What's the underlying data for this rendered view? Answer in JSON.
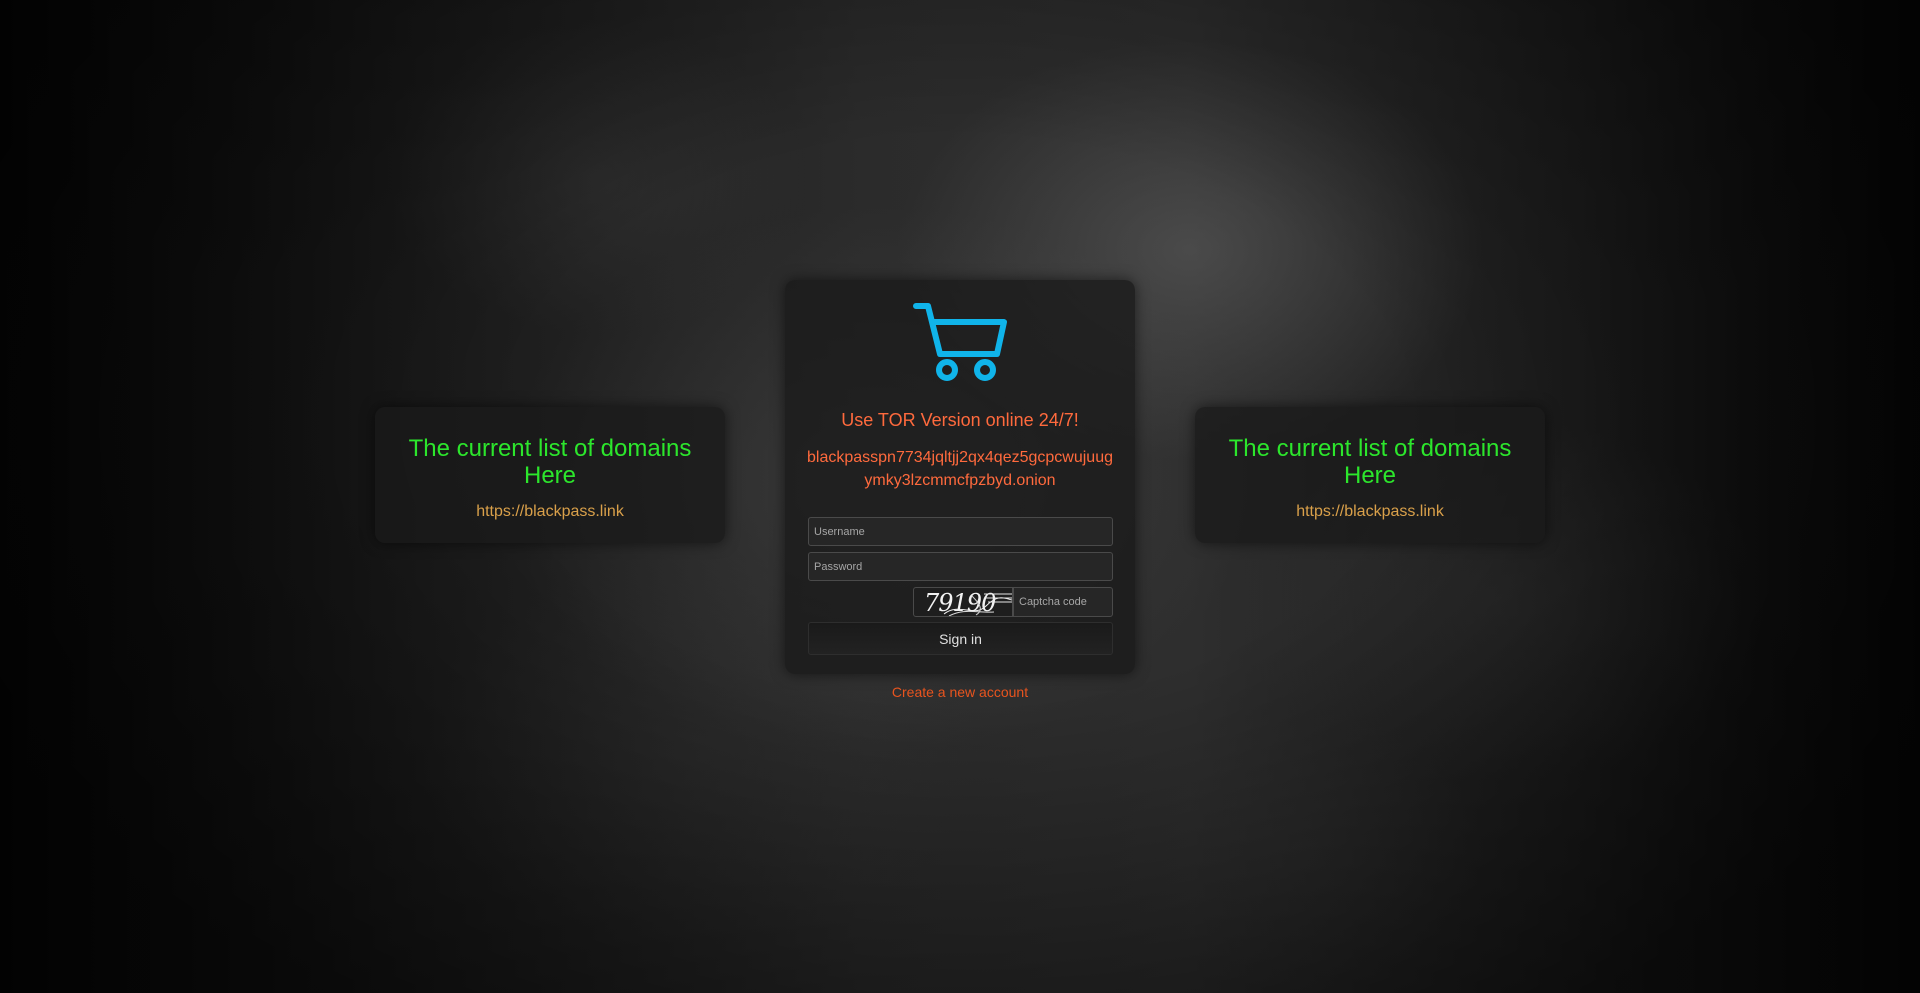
{
  "left_panel": {
    "title": "The current list of domains Here",
    "link": "https://blackpass.link"
  },
  "right_panel": {
    "title": "The current list of domains Here",
    "link": "https://blackpass.link"
  },
  "login": {
    "icon": "shopping-cart-icon",
    "icon_color": "#10b4ea",
    "tor_heading": "Use TOR Version online 24/7!",
    "onion_address": "blackpasspn7734jqltjj2qx4qez5gcpcwujuugymky3lzcmmcfpzbyd.onion",
    "username_placeholder": "Username",
    "password_placeholder": "Password",
    "captcha_text": "79190",
    "captcha_placeholder": "Captcha code",
    "signin_label": "Sign in"
  },
  "create_account_label": "Create a new account",
  "colors": {
    "domains_title": "#2ce62c",
    "domains_link": "#d9a04a",
    "tor_text": "#ff6a3d",
    "create_link": "#e8541e"
  }
}
